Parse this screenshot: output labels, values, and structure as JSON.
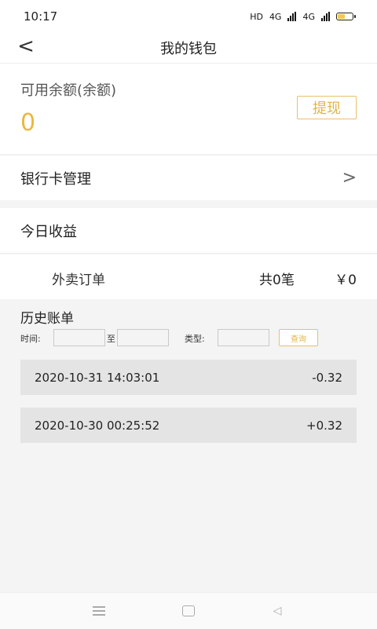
{
  "status": {
    "time": "10:17",
    "hd_label": "HD",
    "net1": "4G",
    "net2": "4G"
  },
  "nav": {
    "title": "我的钱包",
    "back_glyph": "<"
  },
  "balance": {
    "label": "可用余额(余额)",
    "amount": "0",
    "withdraw_label": "提现"
  },
  "bank": {
    "label": "银行卡管理",
    "chevron": ">"
  },
  "today": {
    "label": "今日收益"
  },
  "orders": {
    "name": "外卖订单",
    "count": "共0笔",
    "money": "￥0"
  },
  "history": {
    "title": "历史账单",
    "time_label": "时间:",
    "to_label": "至",
    "type_label": "类型:",
    "query_label": "查询",
    "records": [
      {
        "time": "2020-10-31 14:03:01",
        "amount": "-0.32"
      },
      {
        "time": "2020-10-30 00:25:52",
        "amount": "+0.32"
      }
    ]
  },
  "colors": {
    "accent": "#e9b93d",
    "accent_border": "#e9c06a",
    "background": "#f4f4f4"
  },
  "icons": {
    "back": "chevron-left-icon",
    "bank_chevron": "chevron-right-icon",
    "nav_menu": "menu-icon",
    "nav_home": "home-icon",
    "nav_back": "back-triangle-icon"
  }
}
